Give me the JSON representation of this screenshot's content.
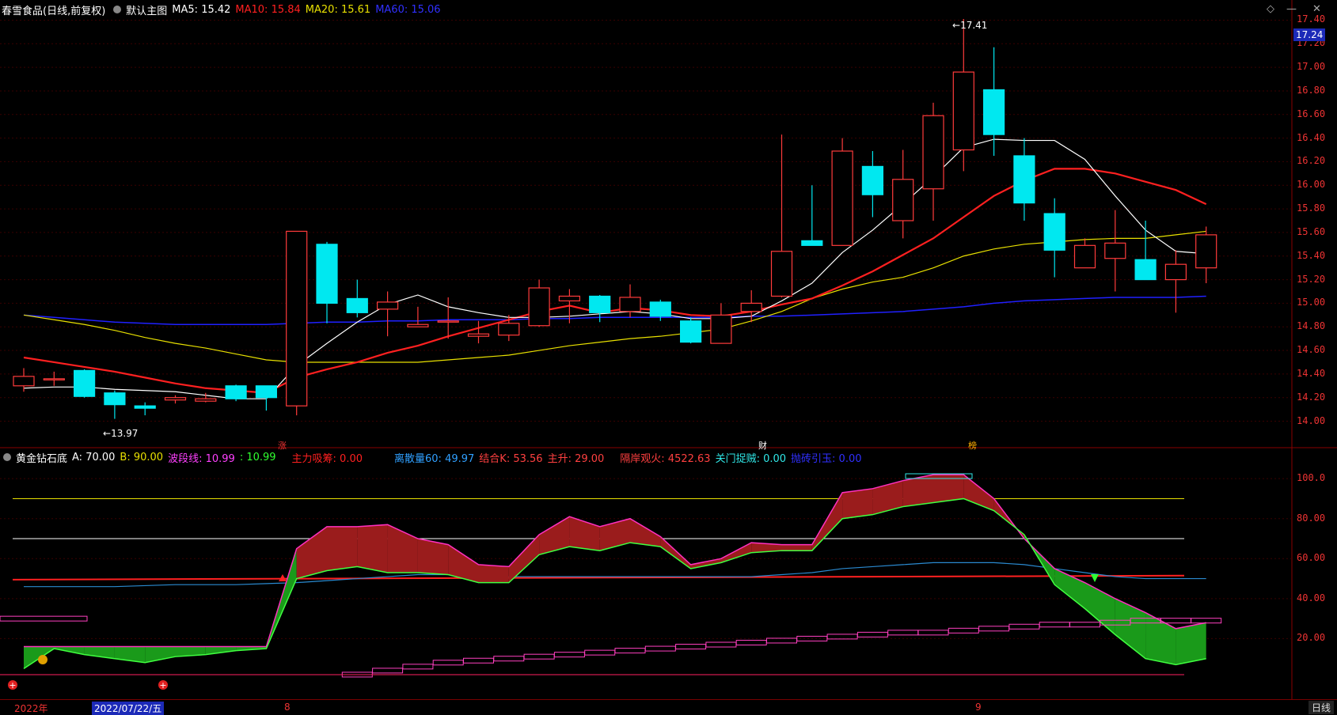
{
  "main_header": {
    "stock": "春雪食品(日线,前复权)",
    "chart_name": "默认主图",
    "ma5": "MA5: 15.42",
    "ma10": "MA10: 15.84",
    "ma20": "MA20: 15.61",
    "ma60": "MA60: 15.06"
  },
  "indicator_header": {
    "name": "黄金钻石底",
    "a": "A: 70.00",
    "b": "B: 90.00",
    "band": "波段线: 10.99",
    "band2": ": 10.99",
    "main_suck": "主力吸筹: 0.00",
    "retail60": "离散量60: 49.97",
    "combine": "结合K: 53.56",
    "main_rise": "主升: 29.00",
    "watch": "隔岸观火: 4522.63",
    "close_door": "关门捉贼: 0.00",
    "hidden": "抛砖引玉: 0.00"
  },
  "price_axis": [
    "17.40",
    "17.20",
    "17.00",
    "16.80",
    "16.60",
    "16.40",
    "16.20",
    "16.00",
    "15.80",
    "15.60",
    "15.40",
    "15.20",
    "15.00",
    "14.80",
    "14.60",
    "14.40",
    "14.20",
    "14.00"
  ],
  "current_price": "17.24",
  "ind_axis": [
    "100.0",
    "80.00",
    "60.00",
    "40.00",
    "20.00"
  ],
  "high_label": "17.41",
  "low_label": "13.97",
  "events": [
    "涨",
    "财",
    "榜"
  ],
  "bottom_bar": {
    "year": "2022年",
    "date": "2022/07/22/五",
    "m8": "8",
    "m9": "9",
    "period": "日线"
  },
  "colors": {
    "up": "#ff3b3b",
    "down": "#00e8f0",
    "ma5": "#ffffff",
    "ma10": "#ff2020",
    "ma20": "#e8e000",
    "ma60": "#2020ff"
  },
  "chart_data": {
    "type": "candlestick",
    "candles": [
      {
        "o": 14.3,
        "h": 14.45,
        "l": 14.25,
        "c": 14.38
      },
      {
        "o": 14.35,
        "h": 14.42,
        "l": 14.3,
        "c": 14.36
      },
      {
        "o": 14.43,
        "h": 14.44,
        "l": 14.2,
        "c": 14.21
      },
      {
        "o": 14.24,
        "h": 14.26,
        "l": 14.02,
        "c": 14.14
      },
      {
        "o": 14.13,
        "h": 14.16,
        "l": 14.05,
        "c": 14.11
      },
      {
        "o": 14.18,
        "h": 14.22,
        "l": 14.15,
        "c": 14.2
      },
      {
        "o": 14.17,
        "h": 14.24,
        "l": 14.16,
        "c": 14.19
      },
      {
        "o": 14.3,
        "h": 14.31,
        "l": 14.17,
        "c": 14.19
      },
      {
        "o": 14.3,
        "h": 14.3,
        "l": 14.09,
        "c": 14.2
      },
      {
        "o": 14.13,
        "h": 15.61,
        "l": 14.05,
        "c": 15.61
      },
      {
        "o": 15.5,
        "h": 15.52,
        "l": 14.83,
        "c": 15.0
      },
      {
        "o": 15.04,
        "h": 15.2,
        "l": 14.88,
        "c": 14.92
      },
      {
        "o": 14.95,
        "h": 15.1,
        "l": 14.72,
        "c": 15.01
      },
      {
        "o": 14.8,
        "h": 14.97,
        "l": 14.8,
        "c": 14.82
      },
      {
        "o": 14.84,
        "h": 15.05,
        "l": 14.7,
        "c": 14.85
      },
      {
        "o": 14.72,
        "h": 14.85,
        "l": 14.66,
        "c": 14.74
      },
      {
        "o": 14.73,
        "h": 14.9,
        "l": 14.68,
        "c": 14.83
      },
      {
        "o": 14.81,
        "h": 15.2,
        "l": 14.8,
        "c": 15.13
      },
      {
        "o": 15.02,
        "h": 15.12,
        "l": 14.83,
        "c": 15.06
      },
      {
        "o": 15.06,
        "h": 15.07,
        "l": 14.84,
        "c": 14.92
      },
      {
        "o": 14.93,
        "h": 15.16,
        "l": 14.88,
        "c": 15.05
      },
      {
        "o": 15.01,
        "h": 15.03,
        "l": 14.85,
        "c": 14.89
      },
      {
        "o": 14.85,
        "h": 14.88,
        "l": 14.66,
        "c": 14.67
      },
      {
        "o": 14.66,
        "h": 15.0,
        "l": 14.66,
        "c": 14.9
      },
      {
        "o": 14.93,
        "h": 15.11,
        "l": 14.84,
        "c": 15.0
      },
      {
        "o": 15.06,
        "h": 16.43,
        "l": 15.05,
        "c": 15.44
      },
      {
        "o": 15.53,
        "h": 16.0,
        "l": 15.5,
        "c": 15.49
      },
      {
        "o": 15.49,
        "h": 16.4,
        "l": 15.49,
        "c": 16.29
      },
      {
        "o": 16.16,
        "h": 16.29,
        "l": 15.73,
        "c": 15.92
      },
      {
        "o": 15.7,
        "h": 16.3,
        "l": 15.55,
        "c": 16.05
      },
      {
        "o": 15.97,
        "h": 16.7,
        "l": 15.7,
        "c": 16.59
      },
      {
        "o": 16.3,
        "h": 17.41,
        "l": 16.12,
        "c": 16.96
      },
      {
        "o": 16.81,
        "h": 17.17,
        "l": 16.25,
        "c": 16.43
      },
      {
        "o": 16.25,
        "h": 16.4,
        "l": 15.7,
        "c": 15.85
      },
      {
        "o": 15.76,
        "h": 15.89,
        "l": 15.22,
        "c": 15.45
      },
      {
        "o": 15.3,
        "h": 15.55,
        "l": 15.3,
        "c": 15.49
      },
      {
        "o": 15.38,
        "h": 15.79,
        "l": 15.1,
        "c": 15.51
      },
      {
        "o": 15.37,
        "h": 15.7,
        "l": 15.22,
        "c": 15.2
      },
      {
        "o": 15.2,
        "h": 15.45,
        "l": 14.92,
        "c": 15.33
      },
      {
        "o": 15.3,
        "h": 15.65,
        "l": 15.17,
        "c": 15.58
      }
    ],
    "ma5": [
      14.28,
      14.29,
      14.29,
      14.27,
      14.26,
      14.25,
      14.22,
      14.19,
      14.19,
      14.47,
      14.66,
      14.84,
      14.99,
      15.07,
      14.97,
      14.92,
      14.88,
      14.88,
      14.89,
      14.91,
      14.93,
      14.91,
      14.87,
      14.87,
      14.89,
      15.02,
      15.17,
      15.43,
      15.62,
      15.84,
      16.07,
      16.32,
      16.39,
      16.38,
      16.38,
      16.22,
      15.91,
      15.62,
      15.44,
      15.42
    ],
    "ma10": [
      14.54,
      14.5,
      14.46,
      14.42,
      14.37,
      14.32,
      14.28,
      14.26,
      14.24,
      14.37,
      14.44,
      14.5,
      14.58,
      14.64,
      14.72,
      14.79,
      14.86,
      14.93,
      14.98,
      14.92,
      14.96,
      14.94,
      14.9,
      14.89,
      14.93,
      14.99,
      15.04,
      15.15,
      15.27,
      15.41,
      15.55,
      15.73,
      15.91,
      16.04,
      16.14,
      16.14,
      16.1,
      16.03,
      15.96,
      15.84
    ],
    "ma20": [
      14.9,
      14.86,
      14.82,
      14.77,
      14.71,
      14.66,
      14.62,
      14.57,
      14.52,
      14.5,
      14.5,
      14.5,
      14.5,
      14.5,
      14.52,
      14.54,
      14.56,
      14.6,
      14.64,
      14.67,
      14.7,
      14.72,
      14.75,
      14.78,
      14.85,
      14.93,
      15.04,
      15.12,
      15.18,
      15.22,
      15.3,
      15.4,
      15.46,
      15.5,
      15.52,
      15.54,
      15.55,
      15.55,
      15.58,
      15.61
    ],
    "ma60": [
      14.9,
      14.88,
      14.86,
      14.84,
      14.83,
      14.82,
      14.82,
      14.82,
      14.82,
      14.83,
      14.84,
      14.84,
      14.85,
      14.85,
      14.86,
      14.86,
      14.86,
      14.87,
      14.87,
      14.88,
      14.88,
      14.88,
      14.88,
      14.88,
      14.89,
      14.89,
      14.9,
      14.91,
      14.92,
      14.93,
      14.95,
      14.97,
      15.0,
      15.02,
      15.03,
      15.04,
      15.05,
      15.05,
      15.05,
      15.06
    ],
    "ind_top": [
      16,
      16,
      16,
      16,
      16,
      16,
      16,
      16,
      16,
      65,
      76,
      76,
      77,
      70,
      67,
      57,
      56,
      72,
      81,
      76,
      80,
      71,
      57,
      60,
      68,
      67,
      67,
      93,
      95,
      99,
      102,
      102,
      90,
      70,
      55,
      48,
      40,
      33,
      25,
      28
    ],
    "ind_bottom": [
      5,
      15,
      12,
      10,
      8,
      11,
      12,
      14,
      15,
      50,
      54,
      56,
      53,
      53,
      52,
      48,
      48,
      62,
      66,
      64,
      68,
      66,
      55,
      58,
      63,
      64,
      64,
      80,
      82,
      86,
      88,
      90,
      84,
      72,
      47,
      35,
      22,
      10,
      7,
      10
    ],
    "line_retail": [
      46,
      46,
      46,
      46,
      46.5,
      47,
      47,
      47,
      47.5,
      48,
      49,
      50,
      51,
      52,
      52,
      51,
      51,
      51,
      51,
      51,
      51,
      51,
      51,
      51,
      51,
      52,
      53,
      55,
      56,
      57,
      58,
      58,
      58,
      57,
      55,
      53,
      51,
      50,
      50,
      50
    ],
    "line_red": 49.5,
    "line_a": 70,
    "line_b": 90,
    "stair": [
      0,
      0,
      0,
      0,
      0,
      0,
      0,
      0,
      0,
      0,
      0,
      2,
      4,
      6,
      8,
      9,
      10,
      11,
      12,
      13,
      14,
      15,
      16,
      17,
      18,
      19,
      20,
      21,
      22,
      23,
      23,
      24,
      25,
      26,
      27,
      27,
      28,
      29,
      29,
      29
    ]
  }
}
